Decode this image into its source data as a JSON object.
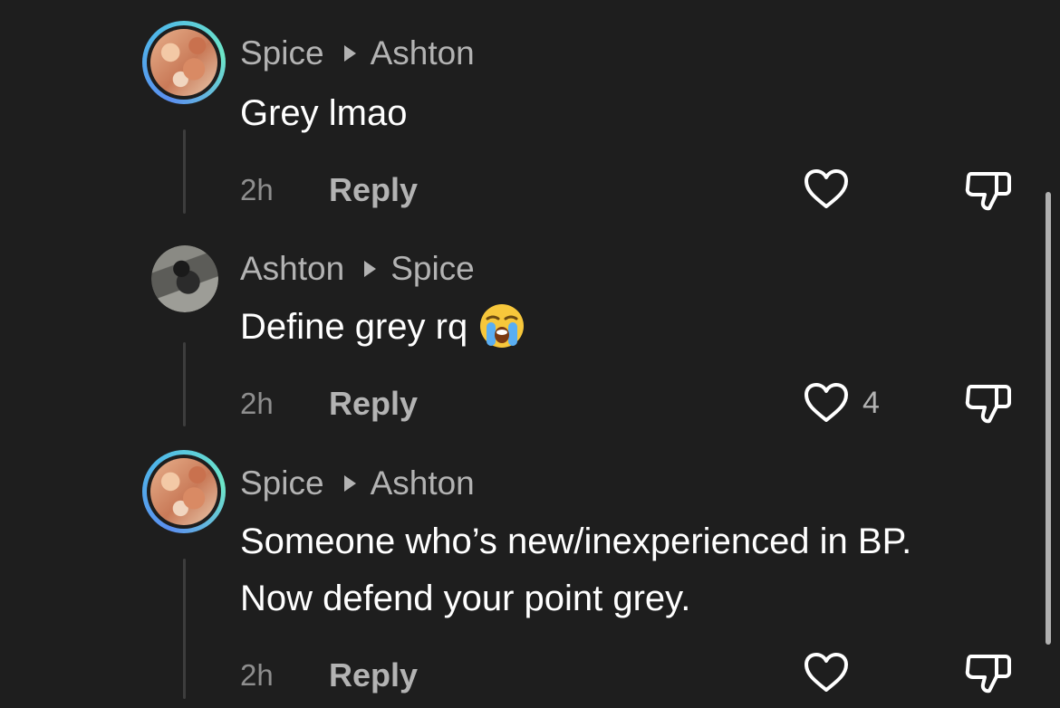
{
  "comments": [
    {
      "author": "Spice",
      "reply_to": "Ashton",
      "text_lines": [
        "Grey lmao"
      ],
      "time": "2h",
      "reply_label": "Reply",
      "likes": ""
    },
    {
      "author": "Ashton",
      "reply_to": "Spice",
      "text_lines": [
        "Define grey rq"
      ],
      "emoji": "loudly-crying-face",
      "time": "2h",
      "reply_label": "Reply",
      "likes": "4"
    },
    {
      "author": "Spice",
      "reply_to": "Ashton",
      "text_lines": [
        "Someone who’s new/inexperienced in BP.",
        "Now defend your point grey."
      ],
      "time": "2h",
      "reply_label": "Reply",
      "likes": ""
    }
  ],
  "colors": {
    "background": "#1e1e1e",
    "text_primary": "#ffffff",
    "text_secondary": "#b3b3b3",
    "ring_gradient": [
      "#5b8ff0",
      "#6ee7c8"
    ]
  },
  "icons": [
    "heart-outline-icon",
    "thumbs-down-outline-icon",
    "play-arrow-icon"
  ]
}
